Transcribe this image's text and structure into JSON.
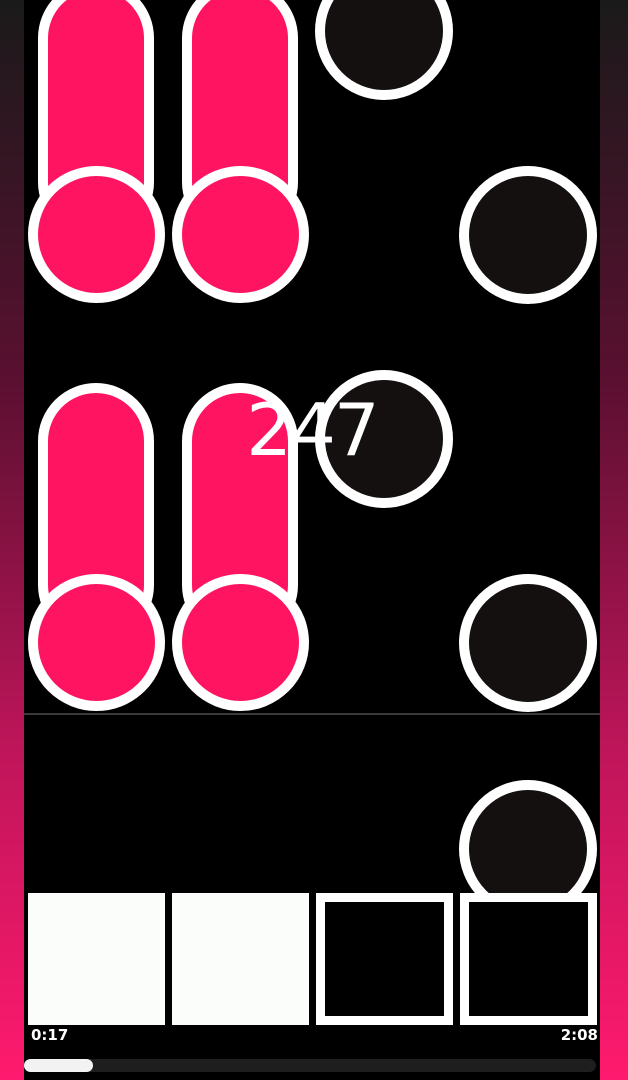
{
  "combo": "247",
  "time": {
    "elapsed": "0:17",
    "total": "2:08"
  },
  "progress": 0.12,
  "colors": {
    "hold_note": "#ff1462",
    "tap_note": "#141010",
    "outline": "#ffffff",
    "key_pressed": "#fafdfa"
  },
  "lanes": [
    {
      "key_state": "pressed"
    },
    {
      "key_state": "pressed"
    },
    {
      "key_state": "idle"
    },
    {
      "key_state": "idle"
    }
  ]
}
